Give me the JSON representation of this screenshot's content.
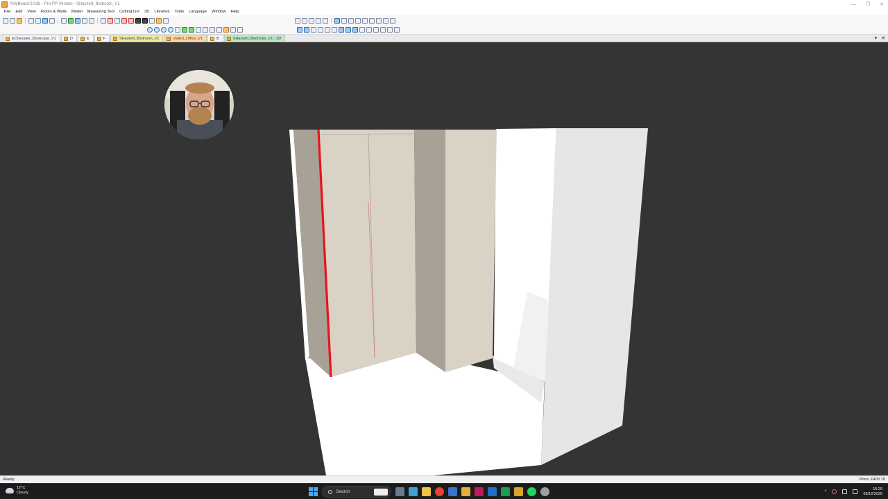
{
  "window": {
    "title": "PolyBoard 8.02b - Pro-PP Version - SHackett_Bedroom_V1",
    "controls": [
      "minimize",
      "restore",
      "close"
    ]
  },
  "menu": [
    "File",
    "Edit",
    "View",
    "Floors & Walls",
    "Model",
    "Measuring Tool",
    "Cutting List",
    "3D",
    "Libraries",
    "Tools",
    "Language",
    "Window",
    "Help"
  ],
  "tabs": [
    {
      "label": "EChevalier_Bookcase_V1",
      "state": "normal"
    },
    {
      "label": "D",
      "state": "normal"
    },
    {
      "label": "E",
      "state": "normal"
    },
    {
      "label": "F",
      "state": "normal"
    },
    {
      "label": "SHackett_Bedroom_V1",
      "state": "yellow"
    },
    {
      "label": "VElliot_Office_V1",
      "state": "orange"
    },
    {
      "label": "B",
      "state": "normal"
    },
    {
      "label": "SHackett_Bedroom_V1 - 3D",
      "state": "active"
    }
  ],
  "tab_controls": {
    "dropdown": "▾",
    "close": "✕"
  },
  "viewport": {
    "scene": "3d-wardrobe-room",
    "colors": {
      "background": "#343434",
      "floor": "#ffffff",
      "side_panel": "#a8a196",
      "door_panel": "#d9d2c5",
      "selected_edge": "#e8141b",
      "right_wall": "#e6e6e6"
    }
  },
  "status": {
    "left": "Ready",
    "right": "Price: £403.19"
  },
  "taskbar": {
    "weather_temp": "12°C",
    "weather_desc": "Cloudy",
    "search_label": "Search",
    "time": "16:29",
    "date": "09/12/2025",
    "app_colors": [
      "#6b7a8f",
      "#e0e0e0",
      "#d17a2b",
      "#f2c34a",
      "#e94335",
      "#3b73c7",
      "#1f6fc9",
      "#c01a5a",
      "#2a7bd6",
      "#1d9b4f",
      "#d8a52a",
      "#1ed760",
      "#9aa0a6"
    ]
  }
}
